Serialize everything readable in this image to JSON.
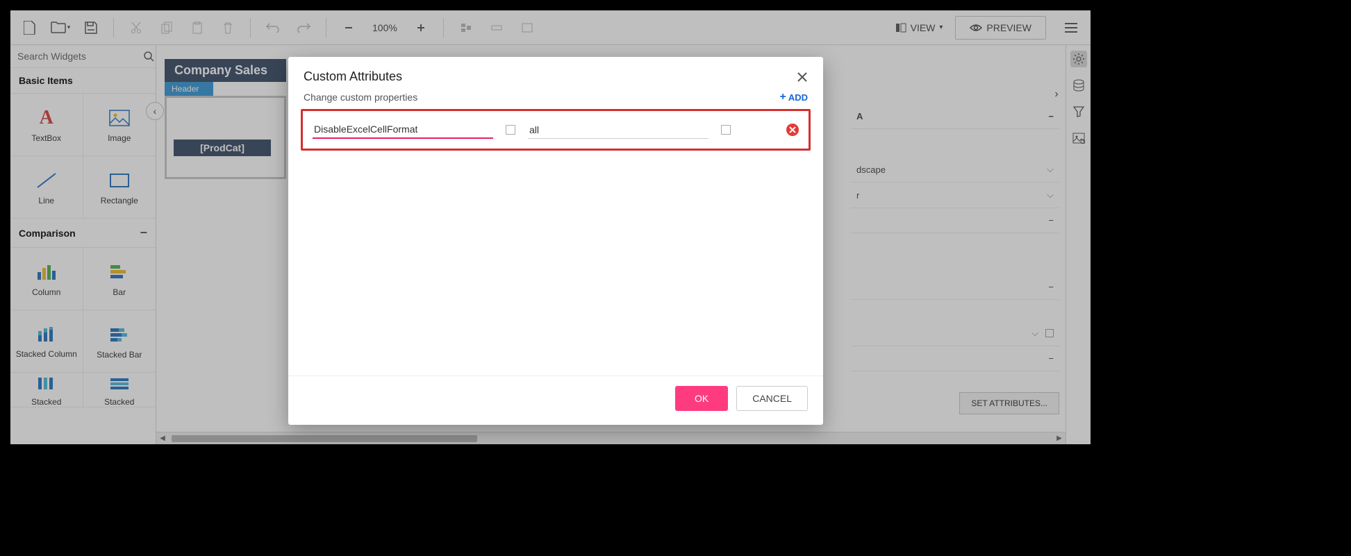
{
  "toolbar": {
    "zoom": "100%",
    "view_label": "VIEW",
    "preview_label": "PREVIEW"
  },
  "sidebar": {
    "search_placeholder": "Search Widgets",
    "sections": {
      "basic": {
        "title": "Basic Items",
        "items": [
          "TextBox",
          "Image",
          "Line",
          "Rectangle"
        ]
      },
      "comparison": {
        "title": "Comparison",
        "items": [
          "Column",
          "Bar",
          "Stacked Column",
          "Stacked Bar",
          "Stacked",
          "Stacked"
        ]
      }
    }
  },
  "canvas": {
    "report_title": "Company Sales",
    "header_tab": "Header",
    "prodcat_label": "[ProdCat]"
  },
  "properties": {
    "landscape": "dscape",
    "paper": "r",
    "data_label": "A",
    "set_attributes_label": "SET ATTRIBUTES..."
  },
  "modal": {
    "title": "Custom Attributes",
    "subtitle": "Change custom properties",
    "add_label": "ADD",
    "row": {
      "name": "DisableExcelCellFormat",
      "value": "all"
    },
    "ok_label": "OK",
    "cancel_label": "CANCEL"
  }
}
